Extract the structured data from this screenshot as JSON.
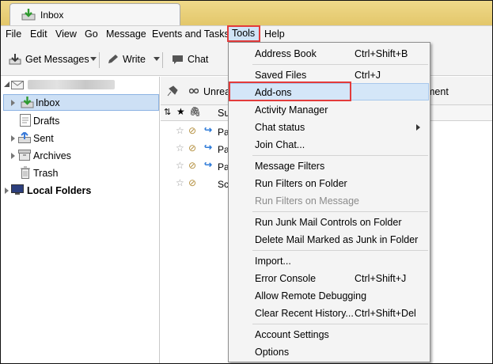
{
  "window": {
    "tab_title": "Inbox"
  },
  "menubar": {
    "items": [
      {
        "label": "File"
      },
      {
        "label": "Edit"
      },
      {
        "label": "View"
      },
      {
        "label": "Go"
      },
      {
        "label": "Message"
      },
      {
        "label": "Events and Tasks"
      },
      {
        "label": "Tools"
      },
      {
        "label": "Help"
      }
    ]
  },
  "toolbar": {
    "get_messages": "Get Messages",
    "write": "Write",
    "chat": "Chat"
  },
  "quick_filter": {
    "unread_label": "Unrea",
    "attachment_label": "ment"
  },
  "folders": {
    "inbox": "Inbox",
    "drafts": "Drafts",
    "sent": "Sent",
    "archives": "Archives",
    "trash": "Trash",
    "local_folders": "Local Folders"
  },
  "thread_columns": {
    "subject": "Su"
  },
  "messages": [
    {
      "subject": "Pa"
    },
    {
      "subject": "Pa"
    },
    {
      "subject": "Pa"
    },
    {
      "subject": "Sc"
    }
  ],
  "tools_menu": {
    "address_book": {
      "label": "Address Book",
      "accel": "Ctrl+Shift+B"
    },
    "saved_files": {
      "label": "Saved Files",
      "accel": "Ctrl+J"
    },
    "add_ons": {
      "label": "Add-ons"
    },
    "activity_manager": {
      "label": "Activity Manager"
    },
    "chat_status": {
      "label": "Chat status"
    },
    "join_chat": {
      "label": "Join Chat..."
    },
    "message_filters": {
      "label": "Message Filters"
    },
    "run_filters_folder": {
      "label": "Run Filters on Folder"
    },
    "run_filters_message": {
      "label": "Run Filters on Message"
    },
    "run_junk": {
      "label": "Run Junk Mail Controls on Folder"
    },
    "delete_junk": {
      "label": "Delete Mail Marked as Junk in Folder"
    },
    "import": {
      "label": "Import..."
    },
    "error_console": {
      "label": "Error Console",
      "accel": "Ctrl+Shift+J"
    },
    "remote_debug": {
      "label": "Allow Remote Debugging"
    },
    "clear_history": {
      "label": "Clear Recent History...",
      "accel": "Ctrl+Shift+Del"
    },
    "account_settings": {
      "label": "Account Settings"
    },
    "options": {
      "label": "Options"
    }
  },
  "colors": {
    "highlight": "#e33b3b",
    "selection": "#cde0f5",
    "tabstrip": "#e8cf7a"
  }
}
